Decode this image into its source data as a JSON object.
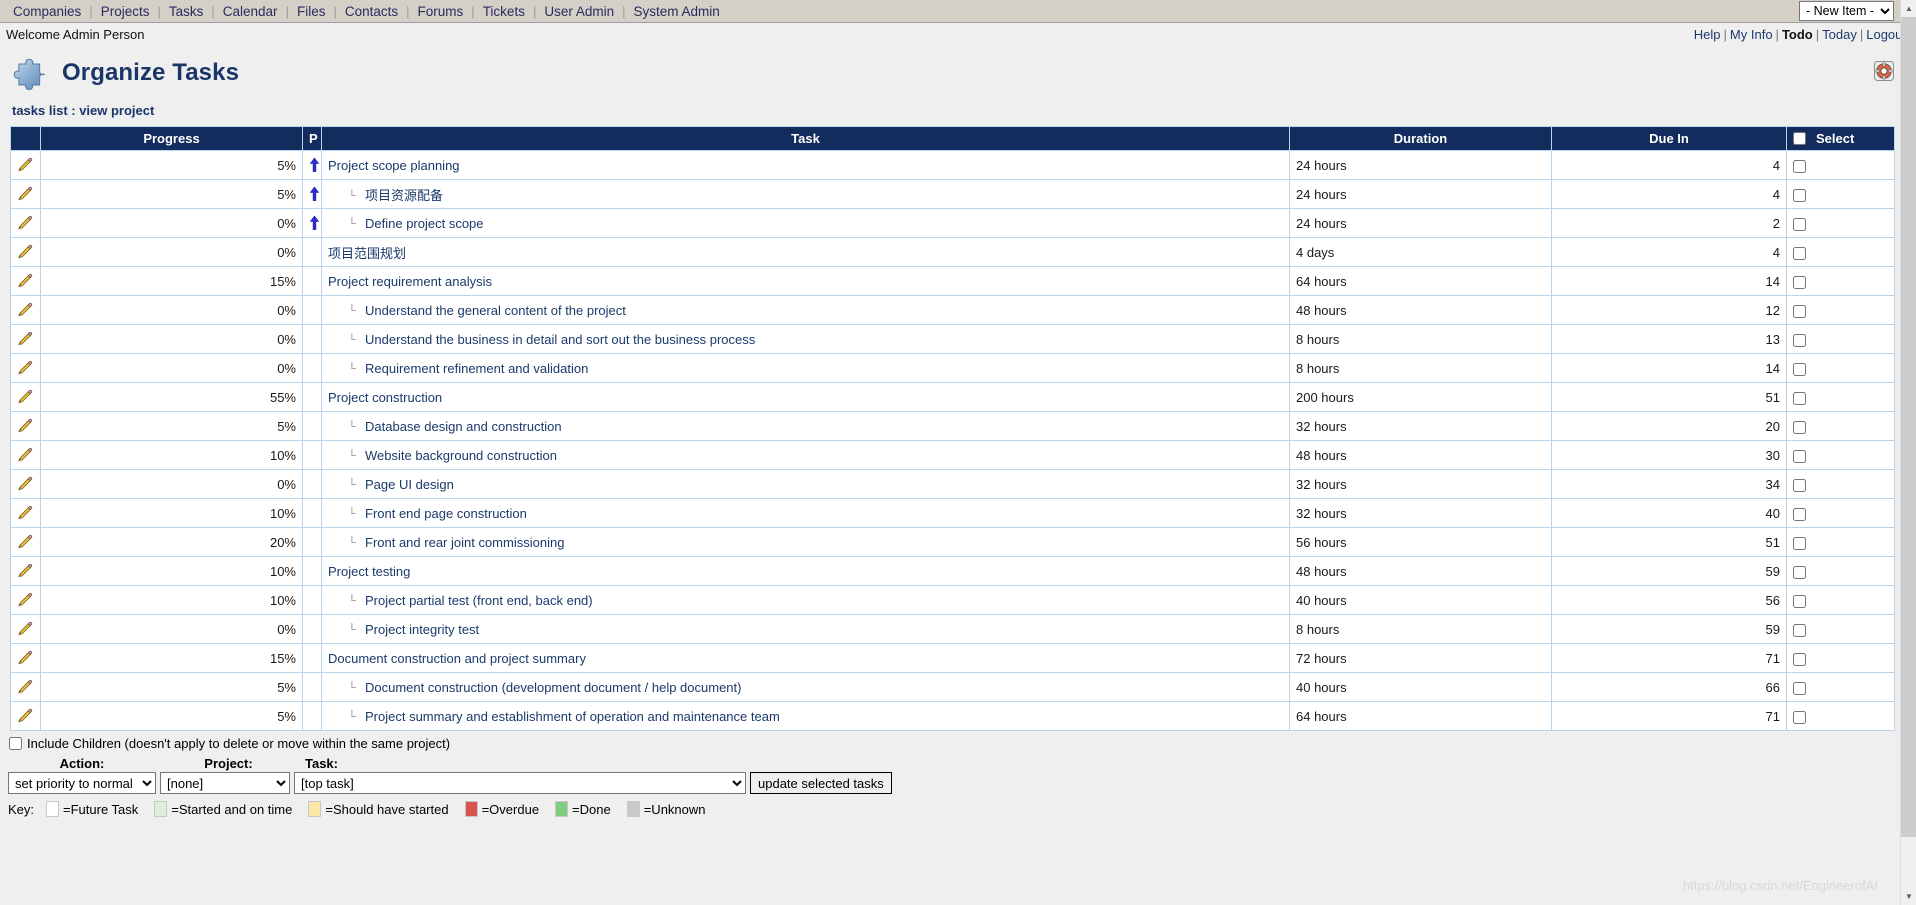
{
  "nav": {
    "items": [
      {
        "label": "Companies"
      },
      {
        "label": "Projects"
      },
      {
        "label": "Tasks"
      },
      {
        "label": "Calendar"
      },
      {
        "label": "Files"
      },
      {
        "label": "Contacts"
      },
      {
        "label": "Forums"
      },
      {
        "label": "Tickets"
      },
      {
        "label": "User Admin"
      },
      {
        "label": "System Admin"
      }
    ],
    "new_item_selected": "- New Item -"
  },
  "userbar": {
    "welcome": "Welcome Admin Person",
    "links": [
      {
        "label": "Help",
        "bold": false
      },
      {
        "label": "My Info",
        "bold": false
      },
      {
        "label": "Todo",
        "bold": true
      },
      {
        "label": "Today",
        "bold": false
      },
      {
        "label": "Logout",
        "bold": false
      }
    ]
  },
  "header": {
    "title": "Organize Tasks",
    "icon": "puzzle-piece-icon",
    "help_icon": "life-ring-icon"
  },
  "breadcrumb": {
    "text": "tasks list : view project"
  },
  "table": {
    "columns": [
      "Progress",
      "P",
      "Task",
      "Duration",
      "Due In",
      "Select"
    ],
    "select_header_label": "Select",
    "rows": [
      {
        "progress": "5%",
        "priority": "up",
        "task": "Project scope planning",
        "indent": 0,
        "duration": "24 hours",
        "due_in": "4"
      },
      {
        "progress": "5%",
        "priority": "up",
        "task": "项目资源配备",
        "indent": 1,
        "duration": "24 hours",
        "due_in": "4"
      },
      {
        "progress": "0%",
        "priority": "up",
        "task": "Define project scope",
        "indent": 1,
        "duration": "24 hours",
        "due_in": "2"
      },
      {
        "progress": "0%",
        "priority": "",
        "task": "项目范围规划",
        "indent": 0,
        "duration": "4 days",
        "due_in": "4"
      },
      {
        "progress": "15%",
        "priority": "",
        "task": "Project requirement analysis",
        "indent": 0,
        "duration": "64 hours",
        "due_in": "14"
      },
      {
        "progress": "0%",
        "priority": "",
        "task": "Understand the general content of the project",
        "indent": 1,
        "duration": "48 hours",
        "due_in": "12"
      },
      {
        "progress": "0%",
        "priority": "",
        "task": "Understand the business in detail and sort out the business process",
        "indent": 1,
        "duration": "8 hours",
        "due_in": "13"
      },
      {
        "progress": "0%",
        "priority": "",
        "task": "Requirement refinement and validation",
        "indent": 1,
        "duration": "8 hours",
        "due_in": "14"
      },
      {
        "progress": "55%",
        "priority": "",
        "task": "Project construction",
        "indent": 0,
        "duration": "200 hours",
        "due_in": "51"
      },
      {
        "progress": "5%",
        "priority": "",
        "task": "Database design and construction",
        "indent": 1,
        "duration": "32 hours",
        "due_in": "20"
      },
      {
        "progress": "10%",
        "priority": "",
        "task": "Website background construction",
        "indent": 1,
        "duration": "48 hours",
        "due_in": "30"
      },
      {
        "progress": "0%",
        "priority": "",
        "task": "Page UI design",
        "indent": 1,
        "duration": "32 hours",
        "due_in": "34"
      },
      {
        "progress": "10%",
        "priority": "",
        "task": "Front end page construction",
        "indent": 1,
        "duration": "32 hours",
        "due_in": "40"
      },
      {
        "progress": "20%",
        "priority": "",
        "task": "Front and rear joint commissioning",
        "indent": 1,
        "duration": "56 hours",
        "due_in": "51"
      },
      {
        "progress": "10%",
        "priority": "",
        "task": "Project testing",
        "indent": 0,
        "duration": "48 hours",
        "due_in": "59"
      },
      {
        "progress": "10%",
        "priority": "",
        "task": "Project partial test (front end, back end)",
        "indent": 1,
        "duration": "40 hours",
        "due_in": "56"
      },
      {
        "progress": "0%",
        "priority": "",
        "task": "Project integrity test",
        "indent": 1,
        "duration": "8 hours",
        "due_in": "59"
      },
      {
        "progress": "15%",
        "priority": "",
        "task": "Document construction and project summary",
        "indent": 0,
        "duration": "72 hours",
        "due_in": "71"
      },
      {
        "progress": "5%",
        "priority": "",
        "task": "Document construction (development document / help document)",
        "indent": 1,
        "duration": "40 hours",
        "due_in": "66"
      },
      {
        "progress": "5%",
        "priority": "",
        "task": "Project summary and establishment of operation and maintenance team",
        "indent": 1,
        "duration": "64 hours",
        "due_in": "71"
      }
    ]
  },
  "bottom": {
    "include_children_label": "Include Children (doesn't apply to delete or move within the same project)",
    "action_label": "Action:",
    "project_label": "Project:",
    "task_label": "Task:",
    "action_selected": "set priority to normal",
    "project_selected": "[none]",
    "task_selected": "[top task]",
    "update_button": "update selected tasks"
  },
  "key": {
    "label": "Key:",
    "items": [
      {
        "text": "=Future Task",
        "color": "#ffffff"
      },
      {
        "text": "=Started and on time",
        "color": "#ddeedd"
      },
      {
        "text": "=Should have started",
        "color": "#fbe7a8"
      },
      {
        "text": "=Overdue",
        "color": "#d9534f"
      },
      {
        "text": "=Done",
        "color": "#7fce7f"
      },
      {
        "text": "=Unknown",
        "color": "#c9c9c9"
      }
    ]
  },
  "watermark": {
    "text": "https://blog.csdn.net/EngineerofAI"
  },
  "colors": {
    "header_bg": "#132c5e",
    "nav_bg": "#d4d0c8",
    "link": "#1b3a6b",
    "title": "#1a3668"
  }
}
